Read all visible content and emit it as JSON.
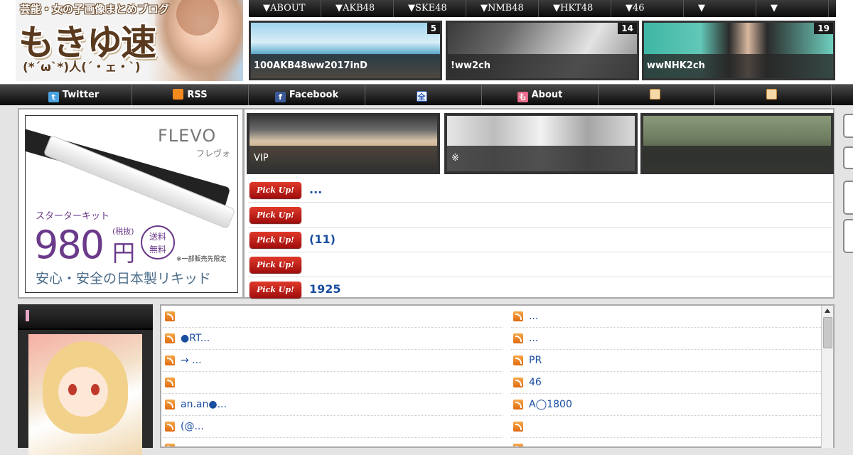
{
  "site": {
    "tagline": "芸能・女の子画像まとめブログ",
    "logo_text": "もきゆ速",
    "logo_face": "(*´ω`*)人(´・ェ・`)"
  },
  "top_nav": [
    "▼ABOUT",
    "▼AKB48",
    "▼SKE48",
    "▼NMB48",
    "▼HKT48",
    "▼46",
    "▼",
    "▼"
  ],
  "top_thumbs": [
    {
      "caption": "100AKB48ww2017inD",
      "count": "5"
    },
    {
      "caption": "!ww2ch",
      "count": "14"
    },
    {
      "caption": "wwNHK2ch",
      "count": "19"
    }
  ],
  "main_nav": [
    {
      "label": "Twitter",
      "icon": "twitter-icon",
      "color": "#4aa3df",
      "glyph": "t"
    },
    {
      "label": "RSS",
      "icon": "rss-icon",
      "color": "#f28a1e",
      "glyph": ""
    },
    {
      "label": "Facebook",
      "icon": "facebook-icon",
      "color": "#3b5998",
      "glyph": "f"
    },
    {
      "label": "",
      "icon": "all-icon",
      "color": "#ffffff",
      "glyph": "全"
    },
    {
      "label": "About",
      "icon": "about-icon",
      "color": "#e86a8a",
      "glyph": "も"
    },
    {
      "label": "",
      "icon": "person-icon",
      "color": "#f6d9a8",
      "glyph": ""
    },
    {
      "label": "",
      "icon": "person-icon",
      "color": "#f6d9a8",
      "glyph": ""
    }
  ],
  "ad": {
    "brand": "FLEVO",
    "brand_kana": "フレヴォ",
    "starter": "スターターキット",
    "price": "980",
    "yen": "円",
    "tax": "(税抜)",
    "shipping": "送料\n無料",
    "note": "※一部販売先限定",
    "made": "安心・安全の日本製リキッド"
  },
  "middle_thumbs": [
    {
      "caption": "VIP"
    },
    {
      "caption": "※"
    },
    {
      "caption": ""
    }
  ],
  "pickup": {
    "button_label": "Pick Up!",
    "items": [
      "...",
      "",
      "(11)",
      "",
      "1925"
    ]
  },
  "feed_left": [
    "",
    "●RT...",
    "→ ...",
    "",
    "an.an●...",
    "(@...",
    ""
  ],
  "feed_right": [
    "...",
    "...",
    "PR",
    "46",
    "A◯1800",
    "",
    ""
  ],
  "colors": {
    "link": "#1a4ea0",
    "pickup_red": "#c0150f",
    "nav_bg": "#111111"
  }
}
